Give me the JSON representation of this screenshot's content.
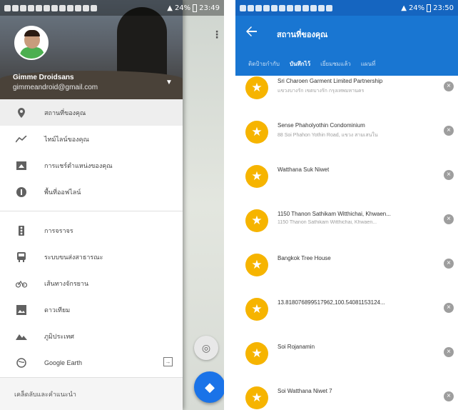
{
  "left_screen": {
    "status_bar": {
      "battery": "24%",
      "time": "23:49"
    },
    "drawer": {
      "user_name": "Gimme Droidsans",
      "user_email": "gimmeandroid@gmail.com",
      "menu_primary": [
        {
          "icon": "location-pin-icon",
          "label": "สถานที่ของคุณ",
          "active": true
        },
        {
          "icon": "timeline-icon",
          "label": "ไทม์ไลน์ของคุณ",
          "active": false
        },
        {
          "icon": "share-location-icon",
          "label": "การแชร์ตำแหน่งของคุณ",
          "active": false
        },
        {
          "icon": "offline-icon",
          "label": "พื้นที่ออฟไลน์",
          "active": false
        }
      ],
      "menu_layers": [
        {
          "icon": "traffic-icon",
          "label": "การจราจร"
        },
        {
          "icon": "transit-icon",
          "label": "ระบบขนส่งสาธารณะ"
        },
        {
          "icon": "bicycle-icon",
          "label": "เส้นทางจักรยาน"
        },
        {
          "icon": "satellite-icon",
          "label": "ดาวเทียม"
        },
        {
          "icon": "terrain-icon",
          "label": "ภูมิประเทศ"
        },
        {
          "icon": "google-earth-icon",
          "label": "Google Earth"
        }
      ],
      "footer_label": "เคล็ดลับและคำแนะนำ"
    }
  },
  "right_screen": {
    "status_bar": {
      "battery": "24%",
      "time": "23:50"
    },
    "title": "สถานที่ของคุณ",
    "tabs": [
      {
        "label": "ติดป้ายกำกับ",
        "active": false
      },
      {
        "label": "บันทึกไว้",
        "active": true
      },
      {
        "label": "เยี่ยมชมแล้ว",
        "active": false
      },
      {
        "label": "แผนที่",
        "active": false
      }
    ],
    "places": [
      {
        "title": "Sri Charoen Garment Limited Partnership",
        "subtitle": "แขวงบางรัก เขตบางรัก กรุงเทพมหานคร"
      },
      {
        "title": "Sense Phaholyothin Condominium",
        "subtitle": "88 Soi Phahon Yothin Road, แขวง สามเสนใน"
      },
      {
        "title": "Watthana Suk Niwet",
        "subtitle": ""
      },
      {
        "title": "1150 Thanon Sathikam Witthichai, Khwaen...",
        "subtitle": "1150 Thanon Sathikam Witthichai, Khwaen..."
      },
      {
        "title": "Bangkok Tree House",
        "subtitle": ""
      },
      {
        "title": "13.818076899517962,100.54081153124...",
        "subtitle": ""
      },
      {
        "title": "Soi Rojanamin",
        "subtitle": ""
      },
      {
        "title": "Soi Watthana Niwet 7",
        "subtitle": ""
      }
    ]
  }
}
